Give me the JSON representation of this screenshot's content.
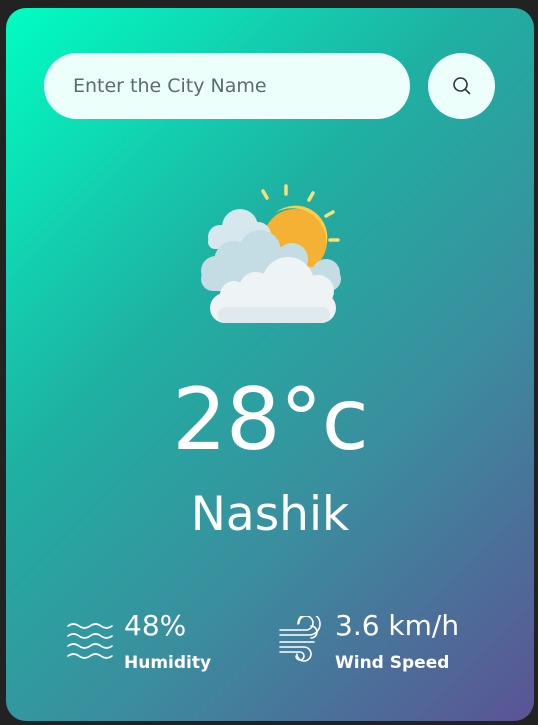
{
  "search": {
    "placeholder": "Enter the City Name",
    "value": "",
    "button_icon": "search-icon"
  },
  "weather": {
    "condition_icon": "partly-cloudy-icon",
    "temperature": "28°c",
    "city": "Nashik"
  },
  "stats": {
    "humidity": {
      "icon": "humidity-waves-icon",
      "value": "48%",
      "label": "Humidity"
    },
    "wind": {
      "icon": "wind-icon",
      "value": "3.6 km/h",
      "label": "Wind Speed"
    }
  },
  "colors": {
    "gradient_start": "#00fec2",
    "gradient_end": "#5b5395",
    "input_background": "#ecfffb",
    "text": "#ffffff"
  }
}
